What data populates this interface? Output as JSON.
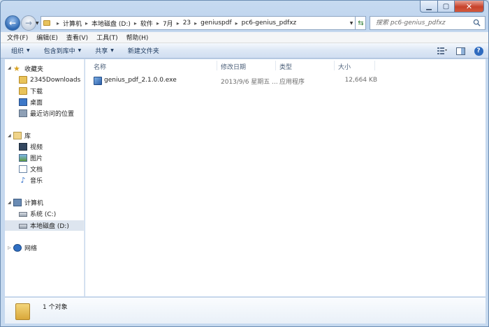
{
  "addressbar": {
    "crumbs": [
      "计算机",
      "本地磁盘 (D:)",
      "软件",
      "7月",
      "23",
      "geniuspdf",
      "pc6-genius_pdfxz"
    ]
  },
  "search": {
    "placeholder": "搜索 pc6-genius_pdfxz"
  },
  "menu": [
    "文件(F)",
    "编辑(E)",
    "查看(V)",
    "工具(T)",
    "帮助(H)"
  ],
  "toolbar": {
    "organize": "组织",
    "include_library": "包含到库中",
    "share": "共享",
    "new_folder": "新建文件夹"
  },
  "nav": {
    "favorites": "收藏夹",
    "fav_items": [
      "2345Downloads",
      "下载",
      "桌面",
      "最近访问的位置"
    ],
    "library": "库",
    "lib_items": [
      "视频",
      "图片",
      "文档",
      "音乐"
    ],
    "computer": "计算机",
    "drives": [
      "系统 (C:)",
      "本地磁盘 (D:)"
    ],
    "network": "网络"
  },
  "columns": {
    "name": "名称",
    "date": "修改日期",
    "type": "类型",
    "size": "大小"
  },
  "files": [
    {
      "name": "genius_pdf_2.1.0.0.exe",
      "date": "2013/9/6 星期五 ...",
      "type": "应用程序",
      "size": "12,664 KB"
    }
  ],
  "status": {
    "count": "1 个对象"
  },
  "colors": {
    "accent": "#2f6bbf",
    "frame": "#bcd3ee",
    "close": "#c7422a"
  }
}
